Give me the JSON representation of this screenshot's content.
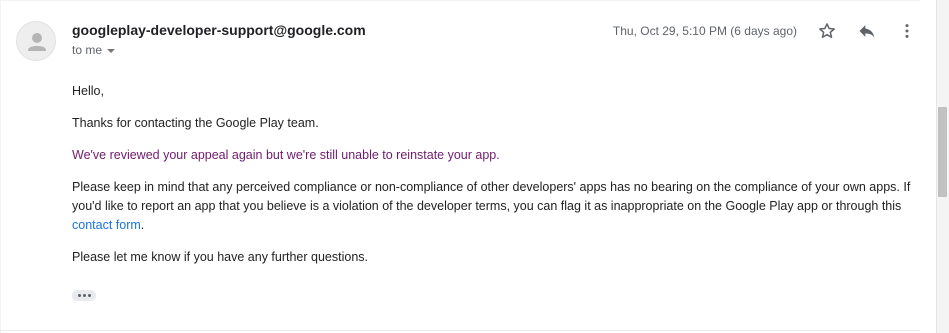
{
  "header": {
    "sender_email": "googleplay-developer-support@google.com",
    "recipient_label": "to me",
    "timestamp": "Thu, Oct 29, 5:10 PM (6 days ago)"
  },
  "icons": {
    "avatar": "person-icon",
    "star": "star-icon",
    "reply": "reply-icon",
    "more": "more-vert-icon",
    "caret": "caret-down-icon",
    "trimmed": "ellipsis-icon"
  },
  "body": {
    "greeting": "Hello,",
    "thanks": "Thanks for contacting the Google Play team.",
    "reviewed": "We've reviewed your appeal again but we're still unable to reinstate your app.",
    "compliance_before_link": "Please keep in mind that any perceived compliance or non-compliance of other developers' apps has no bearing on the compliance of your own apps. If you'd like to report an app that you believe is a violation of the developer terms, you can flag it as inappropriate on the Google Play app or through this ",
    "compliance_link": "contact form",
    "compliance_after_link": ".",
    "further_questions": "Please let me know if you have any further questions."
  },
  "colors": {
    "reviewed_text": "#6f1c6e",
    "link": "#1a73e8",
    "secondary_text": "#5f6368"
  }
}
